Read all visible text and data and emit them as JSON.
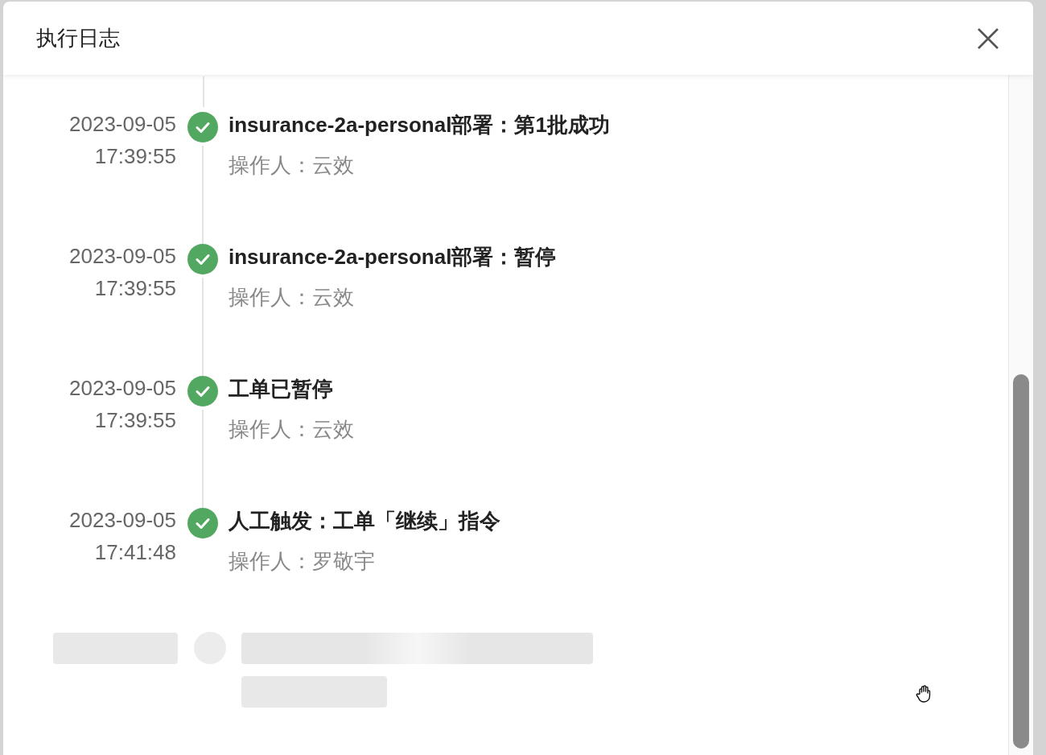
{
  "dialog": {
    "title": "执行日志"
  },
  "entries": [
    {
      "date": "2023-09-05",
      "time": "17:39:55",
      "completed": true,
      "title": "insurance-2a-personal部署：第1批成功",
      "operator_label": "操作人：",
      "operator": "云效"
    },
    {
      "date": "2023-09-05",
      "time": "17:39:55",
      "completed": true,
      "title": "insurance-2a-personal部署：暂停",
      "operator_label": "操作人：",
      "operator": "云效"
    },
    {
      "date": "2023-09-05",
      "time": "17:39:55",
      "completed": true,
      "title": "工单已暂停",
      "operator_label": "操作人：",
      "operator": "云效"
    },
    {
      "date": "2023-09-05",
      "time": "17:41:48",
      "completed": true,
      "title": "人工触发：工单「继续」指令",
      "operator_label": "操作人：",
      "operator": "罗敬宇"
    }
  ],
  "loading": true
}
